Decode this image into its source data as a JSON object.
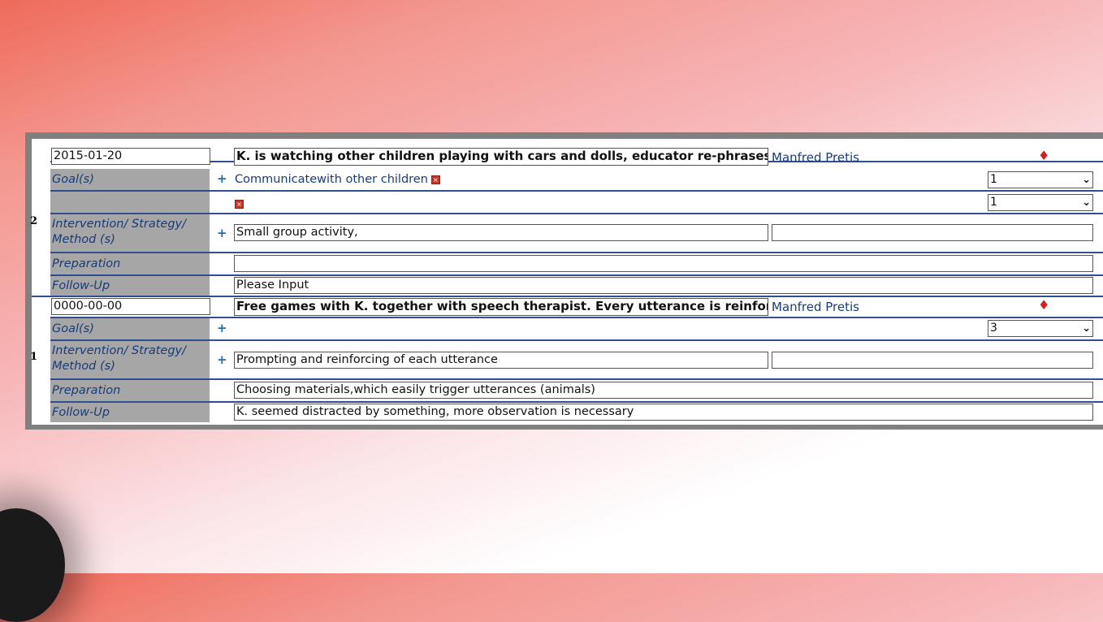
{
  "entries": [
    {
      "number": "2",
      "date": "2015-01-20",
      "description": "K. is watching other children playing with cars and dolls, educator re-phrases",
      "author": "Manfred Pretis",
      "goals_label": "Goal(s)",
      "goal_text": "Communicatewith other children",
      "goal_select_1": "1",
      "goal_select_2": "1",
      "method_label": "Intervention/ Strategy/ Method (s)",
      "method_value": "Small group activity,",
      "method_value_2": "",
      "preparation_label": "Preparation",
      "preparation_value": "",
      "followup_label": "Follow-Up",
      "followup_value": "Please Input"
    },
    {
      "number": "1",
      "date": "0000-00-00",
      "description": "Free games with K. together with speech therapist. Every utterance is reinforced",
      "author": "Manfred Pretis",
      "goals_label": "Goal(s)",
      "goal_select_1": "3",
      "method_label": "Intervention/ Strategy/ Method (s)",
      "method_value": "Prompting and reinforcing of each utterance",
      "method_value_2": "",
      "preparation_label": "Preparation",
      "preparation_value": "Choosing materials,which easily trigger utterances (animals)",
      "followup_label": "Follow-Up",
      "followup_value": "K. seemed distracted by something, more observation is necessary"
    }
  ],
  "icons": {
    "add": "+",
    "remove": "⊠",
    "delete": "delete-diamond-icon",
    "dropdown": "chevron-down-icon"
  },
  "colors": {
    "label_bg": "#a6a6a6",
    "label_text": "#1a3b78",
    "rule": "#2f4f8f",
    "frame": "#808080"
  }
}
